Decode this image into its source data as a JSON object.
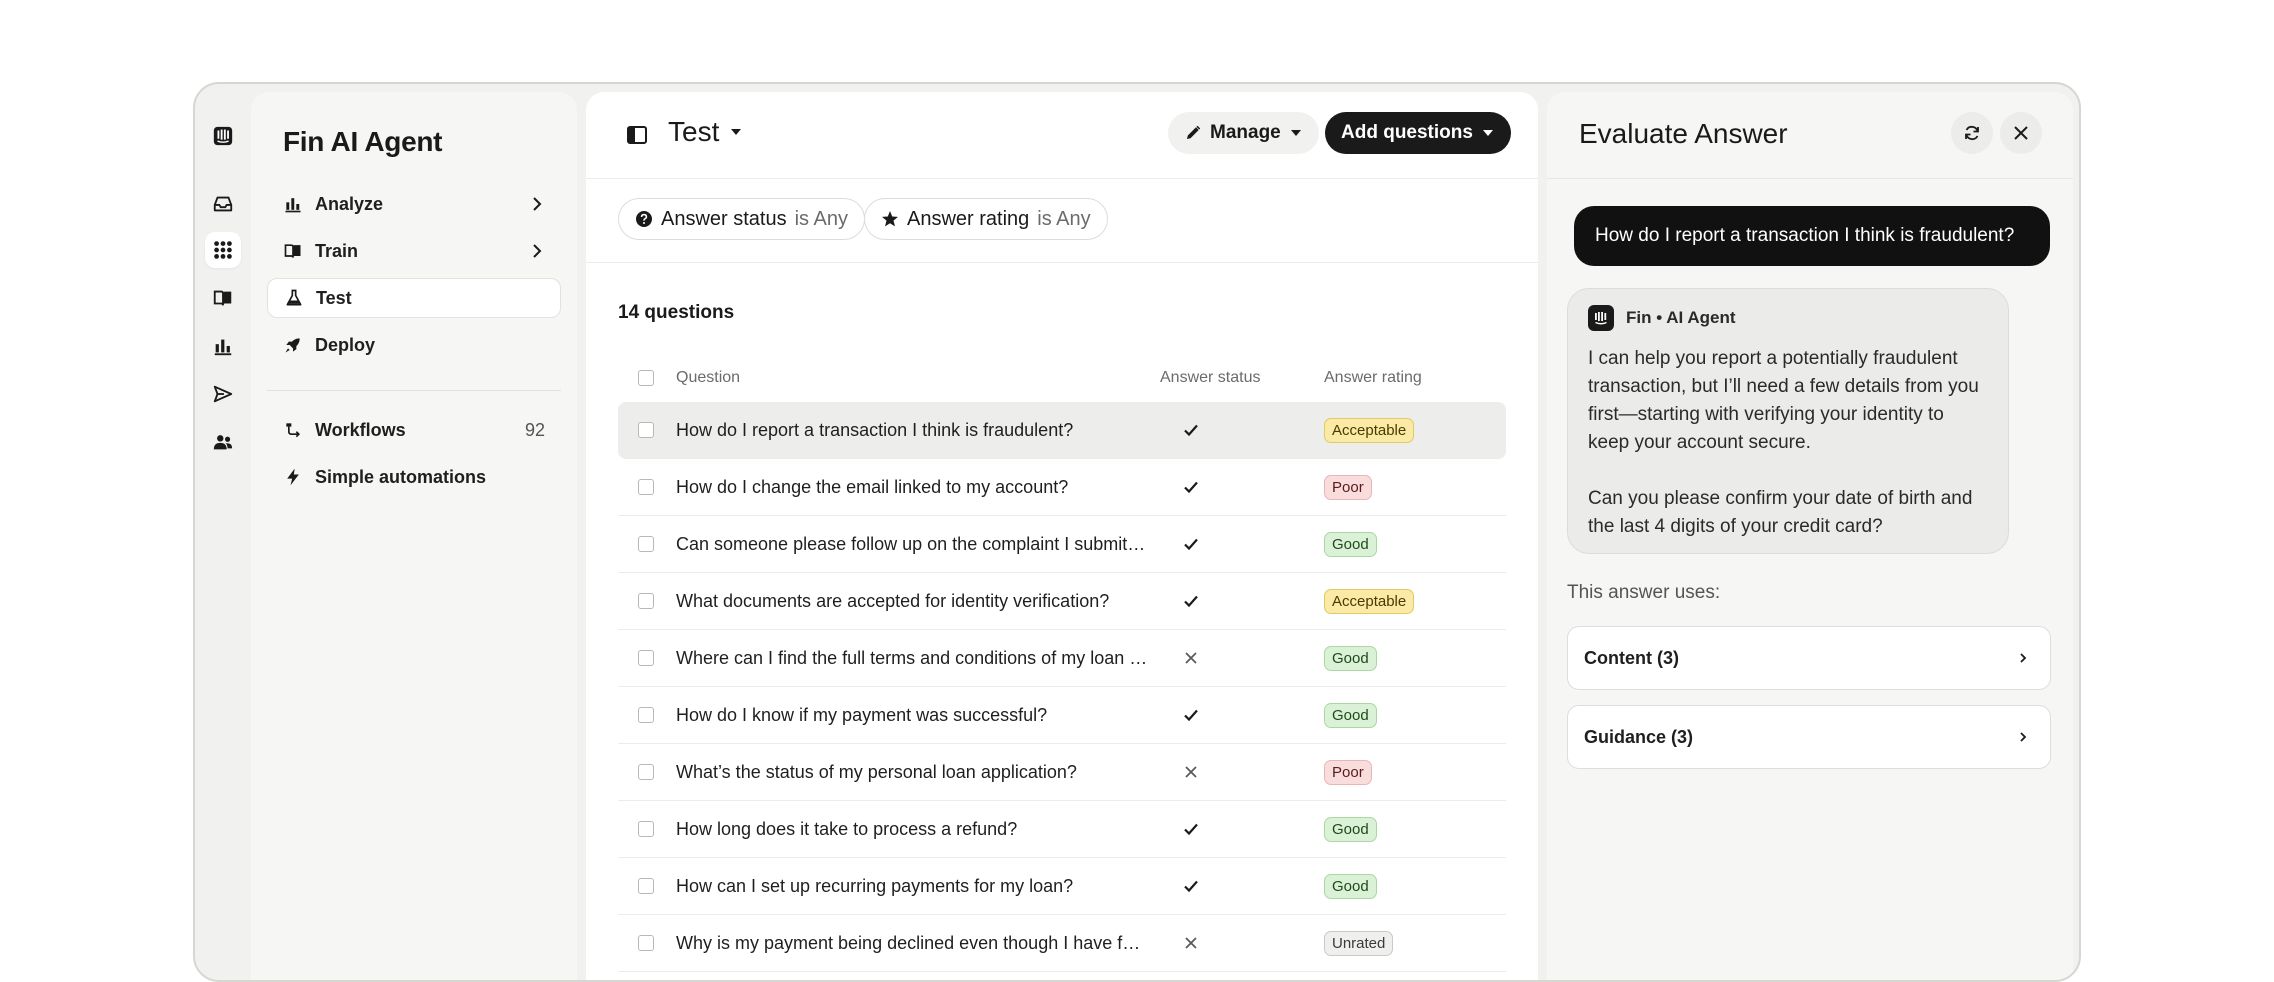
{
  "nav": {
    "title": "Fin AI Agent",
    "items": [
      {
        "label": "Analyze"
      },
      {
        "label": "Train"
      },
      {
        "label": "Test"
      },
      {
        "label": "Deploy"
      }
    ],
    "workflows": {
      "label": "Workflows",
      "count": "92"
    },
    "automations": {
      "label": "Simple automations"
    }
  },
  "main": {
    "title": "Test",
    "manage_label": "Manage",
    "add_label": "Add questions",
    "filters": [
      {
        "name": "Answer status",
        "op": "is Any"
      },
      {
        "name": "Answer rating",
        "op": "is Any"
      }
    ],
    "count_label": "14 questions",
    "columns": {
      "question": "Question",
      "status": "Answer status",
      "rating": "Answer rating"
    },
    "rows": [
      {
        "q": "How do I report a transaction I think is fraudulent?",
        "status": "check",
        "rating": "Acceptable"
      },
      {
        "q": "How do I change the email linked to my account?",
        "status": "check",
        "rating": "Poor"
      },
      {
        "q": "Can someone please follow up on the complaint I submitte...",
        "status": "check",
        "rating": "Good"
      },
      {
        "q": "What documents are accepted for identity verification?",
        "status": "check",
        "rating": "Acceptable"
      },
      {
        "q": "Where can I find the full terms and conditions of my loan a...",
        "status": "cross",
        "rating": "Good"
      },
      {
        "q": "How do I know if my payment was successful?",
        "status": "check",
        "rating": "Good"
      },
      {
        "q": "What’s the status of my personal loan application?",
        "status": "cross",
        "rating": "Poor"
      },
      {
        "q": "How long does it take to process a refund?",
        "status": "check",
        "rating": "Good"
      },
      {
        "q": "How can I set up recurring payments for my loan?",
        "status": "check",
        "rating": "Good"
      },
      {
        "q": "Why is my payment being declined even though I have fun...",
        "status": "cross",
        "rating": "Unrated"
      }
    ]
  },
  "evaluate": {
    "title": "Evaluate Answer",
    "user_message": "How do I report a transaction I think is fraudulent?",
    "agent_name": "Fin • AI Agent",
    "answer_p1": "I can help you report a potentially fraudulent transaction, but I’ll need a few details from you first—starting with verifying your identity to keep your account secure.",
    "answer_p2": "Can you please confirm your date of birth and the last 4 digits of your credit card?",
    "uses_label": "This answer uses:",
    "content_label": "Content (3)",
    "guidance_label": "Guidance (3)"
  },
  "colors": {
    "acceptable": "#fbeaa6",
    "poor": "#f9dcdc",
    "good": "#dbf1d7",
    "unrated": "#efefed",
    "primary_button": "#1a1a1a"
  },
  "icons": {
    "rail": [
      "intercom-logo-icon",
      "inbox-icon",
      "apps-grid-icon",
      "book-icon",
      "bar-chart-icon",
      "send-icon",
      "people-icon"
    ]
  }
}
